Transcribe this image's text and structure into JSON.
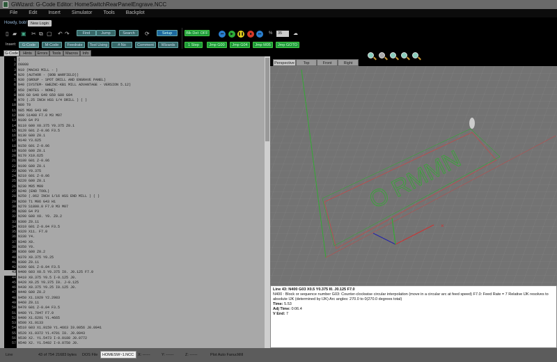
{
  "title": "GWizard: G-Code Editor: HomeSwitchRearPanelEngrave.NCC",
  "menu": [
    "File",
    "Edit",
    "Insert",
    "Simulator",
    "Tools",
    "Backplot"
  ],
  "user": {
    "greeting": "Howdy, bob!",
    "new_login": "New Login"
  },
  "toolbar": {
    "find": "Find",
    "jump": "Jump",
    "search": "Search",
    "setup": "Setup",
    "insert_label": "Insert:",
    "insert_buttons": [
      "G-Code",
      "M-Code",
      "Feedrate",
      "Tool Using",
      "# No",
      "Comment",
      "Wizards"
    ],
    "blk_del": "Blk Del: OFF",
    "speed_label": "%",
    "speed_value": "35",
    "sim_buttons": [
      "1 Step",
      "Jmp G00",
      "Jmp G04",
      "Jmp M05",
      "Jmp GOTO"
    ],
    "colors": {
      "teal": "#396a6a",
      "blue": "#1e6aa0",
      "green": "#1e9a3a"
    }
  },
  "tabs": [
    "G-Code",
    "Hints",
    "Errors",
    "Tools",
    "Macros",
    "Info"
  ],
  "view_tabs": [
    "Perspective",
    "Top",
    "Front",
    "Right"
  ],
  "code": [
    "(",
    "O0000",
    "N10 (MACH3 MILL - )",
    "N20 (AUTHOR - (BOB WARFIELD))",
    "N30 (GROUP - SPOT DRILL AND ENGRAVE PANEL)",
    "N40 (SYSTEM- GWEZNC-KB1 MILL ADVANTAGE - VERSION 5.12)",
    "N50 (NOTES - NONE)",
    "N60 G0 G40 G49 G50 G80 G94",
    "N70 (.25 INCH HSS 1/4 DRILL ) ( )",
    "N80 T0",
    "N85 M06 G43 H0",
    "N90 S1400 F7.0 M3 M07",
    "N100 G4 P3",
    "N110 G00 X0.375 Y0.375 Z0.1",
    "N120 G01 Z-0.06 F3.5",
    "N130 G00 Z0.1",
    "N140 Y3.625",
    "N150 G01 Z-0.06",
    "N160 G00 Z0.1",
    "N170 X10.625",
    "N180 G01 Z-0.06",
    "N190 G00 Z0.1",
    "N200 Y0.375",
    "N210 G01 Z-0.06",
    "N220 G00 Z0.1",
    "N230 M05 M09",
    "N240 (END TOOL)",
    "N250 (.062 INCH 1/16 HSS END MILL ) ( )",
    "N260 T1 M06 G43 H1",
    "N270 S1800.0 F7.0 M3 M07",
    "N280 G4 P3",
    "N290 G00 X0. Y0. Z0.2",
    "N300 Z0.11",
    "N310 G01 Z-0.04 F3.5",
    "N320 X11. F7.0",
    "N330 Y4.",
    "N340 X0.",
    "N350 Y0.",
    "N360 G00 Z0.2",
    "N370 X0.375 Y0.25",
    "N380 Z0.11",
    "N390 G01 Z-0.04 F3.5",
    "N400 G03 X0.5 Y0.375 I0. J0.125 F7.0",
    "N410 X0.375 Y0.5 I-0.125 J0.",
    "N420 X0.25 Y0.375 I0. J-0.125",
    "N430 X0.375 Y0.25 I0.125 J0.",
    "N440 G00 Z0.2",
    "N450 X1.1929 Y2.2983",
    "N460 Z0.11",
    "N470 G01 Z-0.04 F3.5",
    "N480 Y1.7047 F7.0",
    "N490 X1.6291 Y1.4665",
    "N500 X1.9133",
    "N510 G03 X1.9159 Y1.4663 I0.0056 J0.0941",
    "N520 X1.9372 Y1.4701 I0. J0.0943",
    "N530 X2. Y1.5473 I-0.0188 J0.0772",
    "N540 X2. Y1.5492 I-0.0750 J0."
  ],
  "current_line": 43,
  "info": {
    "line": "Line 43: N400 G03 X0.5 Y0.375 I0. J0.125 F7.0",
    "desc": "N400 : Block or sequence number G03: Counter-clockwise circular interpolation (move in a circular arc at feed speed) F7.0: Feed Rate = 7 Relative IJK resolves to absolute IJK (determined by IJK) Arc angles: 270.0 to 0(270.0 degrees total)",
    "time_label": "Time:",
    "time": "5.53",
    "adj_label": "Adj Time:",
    "adj": "0:06.4",
    "vend_label": "V End:",
    "vend": "7"
  },
  "status": {
    "line_label": "Line",
    "position": "43 of 754",
    "bytes": "21683 bytes",
    "dos_label": "DOS File",
    "dos_value": "HOMESW~1.NCC",
    "x": "X: ------",
    "y": "Y: ------",
    "z": "Z: ------",
    "plot": "Plot Auto FanucMill"
  }
}
